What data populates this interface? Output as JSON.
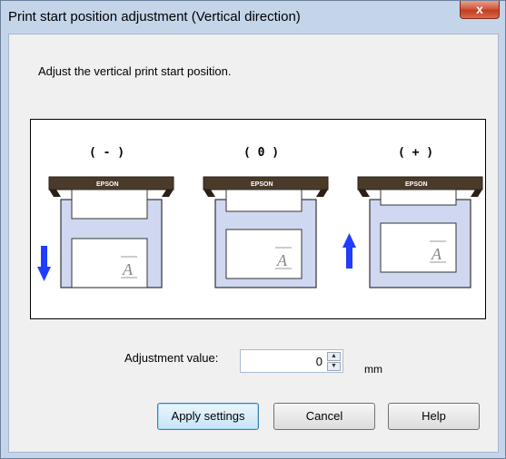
{
  "window": {
    "title": "Print start position adjustment (Vertical direction)",
    "close_glyph": "x"
  },
  "instruction": "Adjust the vertical print start position.",
  "illustration": {
    "labels": [
      "( - )",
      "( 0 )",
      "( + )"
    ],
    "brand": "EPSON",
    "paper_glyph": "A",
    "arrows": [
      "arrow-down-icon",
      "",
      "arrow-up-icon"
    ],
    "arrow_color": "#1f3cff",
    "tray_color": "#cfd8f0"
  },
  "adjustment": {
    "label": "Adjustment value:",
    "value": "0",
    "unit": "mm"
  },
  "buttons": {
    "apply": "Apply settings",
    "cancel": "Cancel",
    "help": "Help"
  }
}
